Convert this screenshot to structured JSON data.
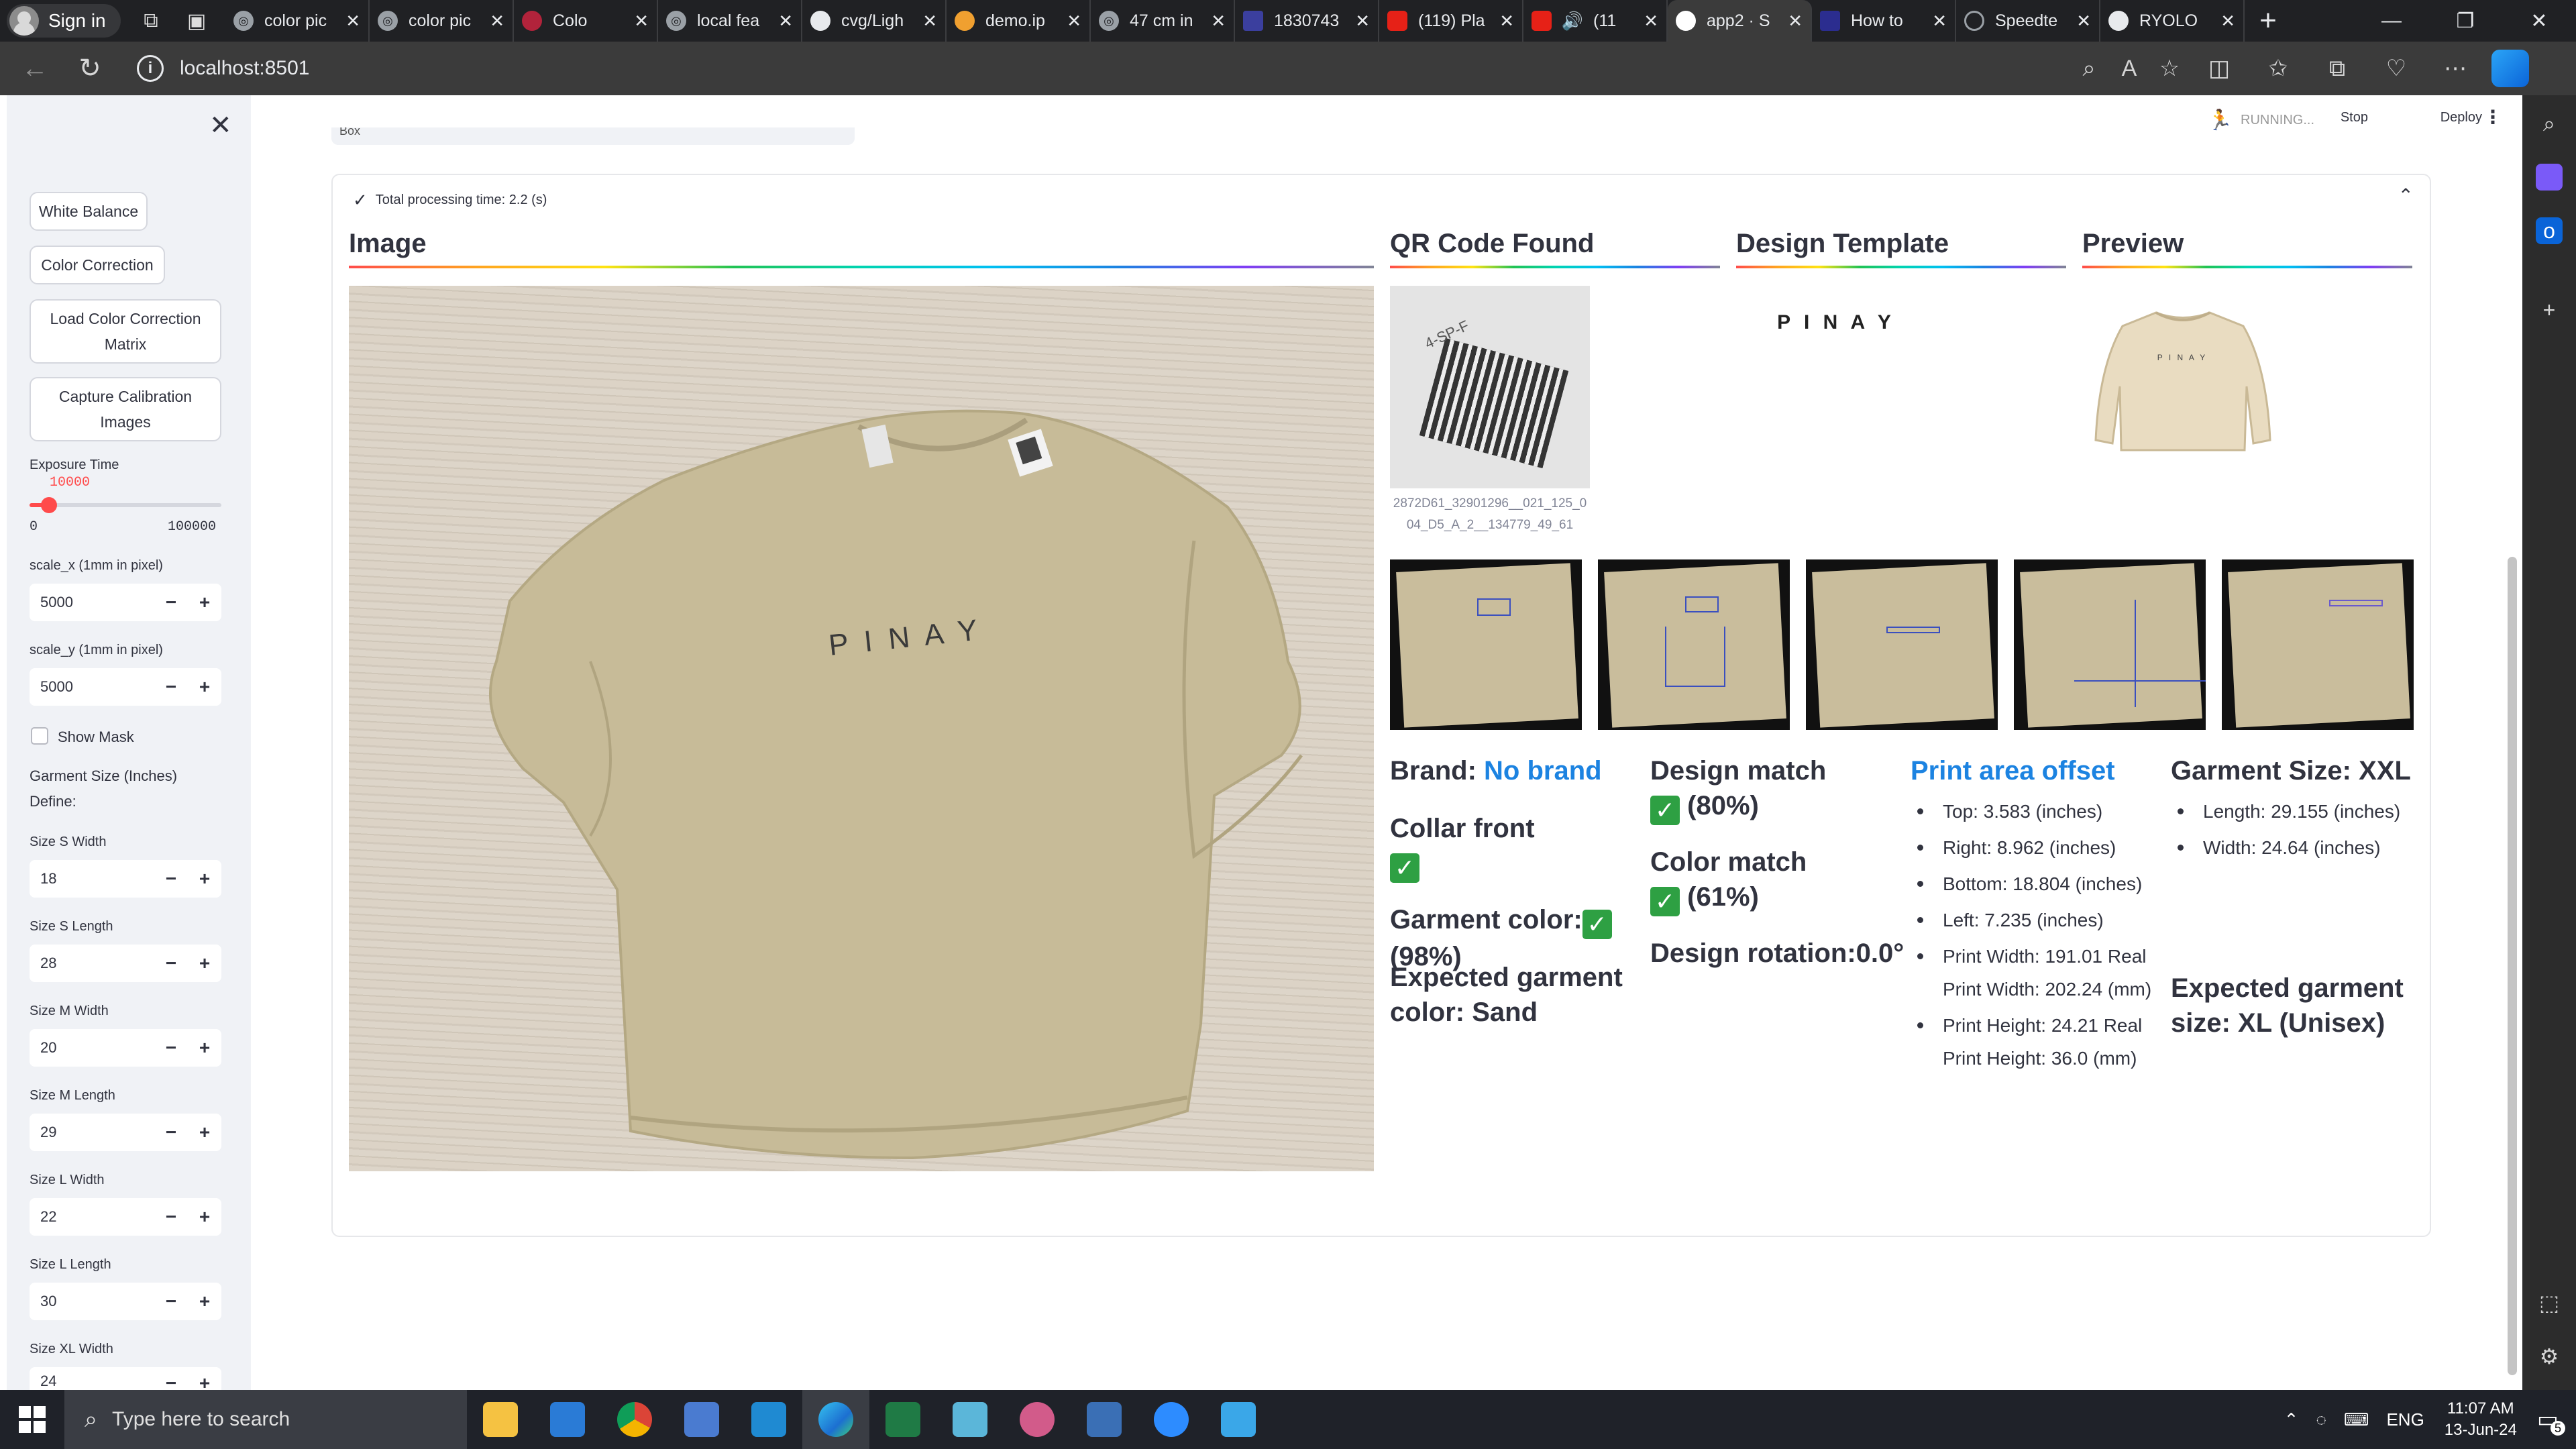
{
  "browser": {
    "profile_label": "Sign in",
    "tabs": [
      {
        "label": "color pic",
        "active": false
      },
      {
        "label": "color pic",
        "active": false
      },
      {
        "label": "Colo",
        "active": false
      },
      {
        "label": "local fea",
        "active": false
      },
      {
        "label": "cvg/Ligh",
        "active": false
      },
      {
        "label": "demo.ip",
        "active": false
      },
      {
        "label": "47 cm in",
        "active": false
      },
      {
        "label": "1830743",
        "active": false
      },
      {
        "label": "(119) Pla",
        "active": false
      },
      {
        "label": "(11",
        "active": false
      },
      {
        "label": "app2 · S",
        "active": true
      },
      {
        "label": "How to",
        "active": false
      },
      {
        "label": "Speedte",
        "active": false
      },
      {
        "label": "RYOLO",
        "active": false
      }
    ],
    "url": "localhost:8501"
  },
  "sidebar": {
    "buttons": [
      "White Balance",
      "Color Correction",
      "Load Color Correction Matrix",
      "Capture Calibration Images"
    ],
    "exposure": {
      "label": "Exposure Time",
      "value": "10000",
      "min": "0",
      "max": "100000",
      "fraction": 0.1
    },
    "scale_x": {
      "label": "scale_x (1mm in pixel)",
      "value": "5000"
    },
    "scale_y": {
      "label": "scale_y (1mm in pixel)",
      "value": "5000"
    },
    "show_mask": "Show Mask",
    "garment_size_heading": "Garment Size (Inches)",
    "define_label": "Define:",
    "sizes": [
      {
        "label": "Size S Width",
        "value": "18"
      },
      {
        "label": "Size S Length",
        "value": "28"
      },
      {
        "label": "Size M Width",
        "value": "20"
      },
      {
        "label": "Size M Length",
        "value": "29"
      },
      {
        "label": "Size L Width",
        "value": "22"
      },
      {
        "label": "Size L Length",
        "value": "30"
      },
      {
        "label": "Size XL Width",
        "value": "24"
      }
    ]
  },
  "header": {
    "status": "RUNNING...",
    "stop": "Stop",
    "deploy": "Deploy"
  },
  "stub_text": "Box",
  "expander": {
    "title": "Total processing time: 2.2 (s)"
  },
  "sections": {
    "image": "Image",
    "qr": "QR Code Found",
    "design": "Design Template",
    "preview": "Preview"
  },
  "qr_caption": "2872D61_32901296__021_125_004_D5_A_2__134779_49_61",
  "shirt_text": "P I N A Y",
  "design_text": "P I N A Y",
  "preview_text": "P I N A Y",
  "qr_label_text": "4-SP-F",
  "results": {
    "brand_label": "Brand:",
    "brand_value": "No brand",
    "collar_label": "Collar front",
    "garment_color_label": "Garment color:",
    "garment_color_pct": "(98%)",
    "expected_color_line1": "Expected garment",
    "expected_color_line2": "color: Sand",
    "design_match_label": "Design match",
    "design_match_pct": "(80%)",
    "color_match_label": "Color match",
    "color_match_pct": "(61%)",
    "design_rotation": "Design rotation:0.0°",
    "print_area_heading": "Print area offset",
    "print_area_items": [
      "Top: 3.583 (inches)",
      "Right: 8.962 (inches)",
      "Bottom: 18.804 (inches)",
      "Left: 7.235 (inches)",
      "Print Width: 191.01 Real Print Width: 202.24 (mm)",
      "Print Height: 24.21 Real Print Height: 36.0 (mm)"
    ],
    "garment_size_heading": "Garment Size: XXL",
    "garment_size_items": [
      "Length: 29.155 (inches)",
      "Width: 24.64 (inches)"
    ],
    "expected_size_line1": "Expected garment",
    "expected_size_line2": "size: XL (Unisex)"
  },
  "taskbar": {
    "search_placeholder": "Type here to search",
    "lang": "ENG",
    "time": "11:07 AM",
    "date": "13-Jun-24",
    "notif_count": "5"
  },
  "colors": {
    "accent": "#ff4b4b",
    "link": "#1c83e1",
    "check": "#2ea043",
    "shirt": "#c9bd9c",
    "table": "#d9d0c4"
  }
}
